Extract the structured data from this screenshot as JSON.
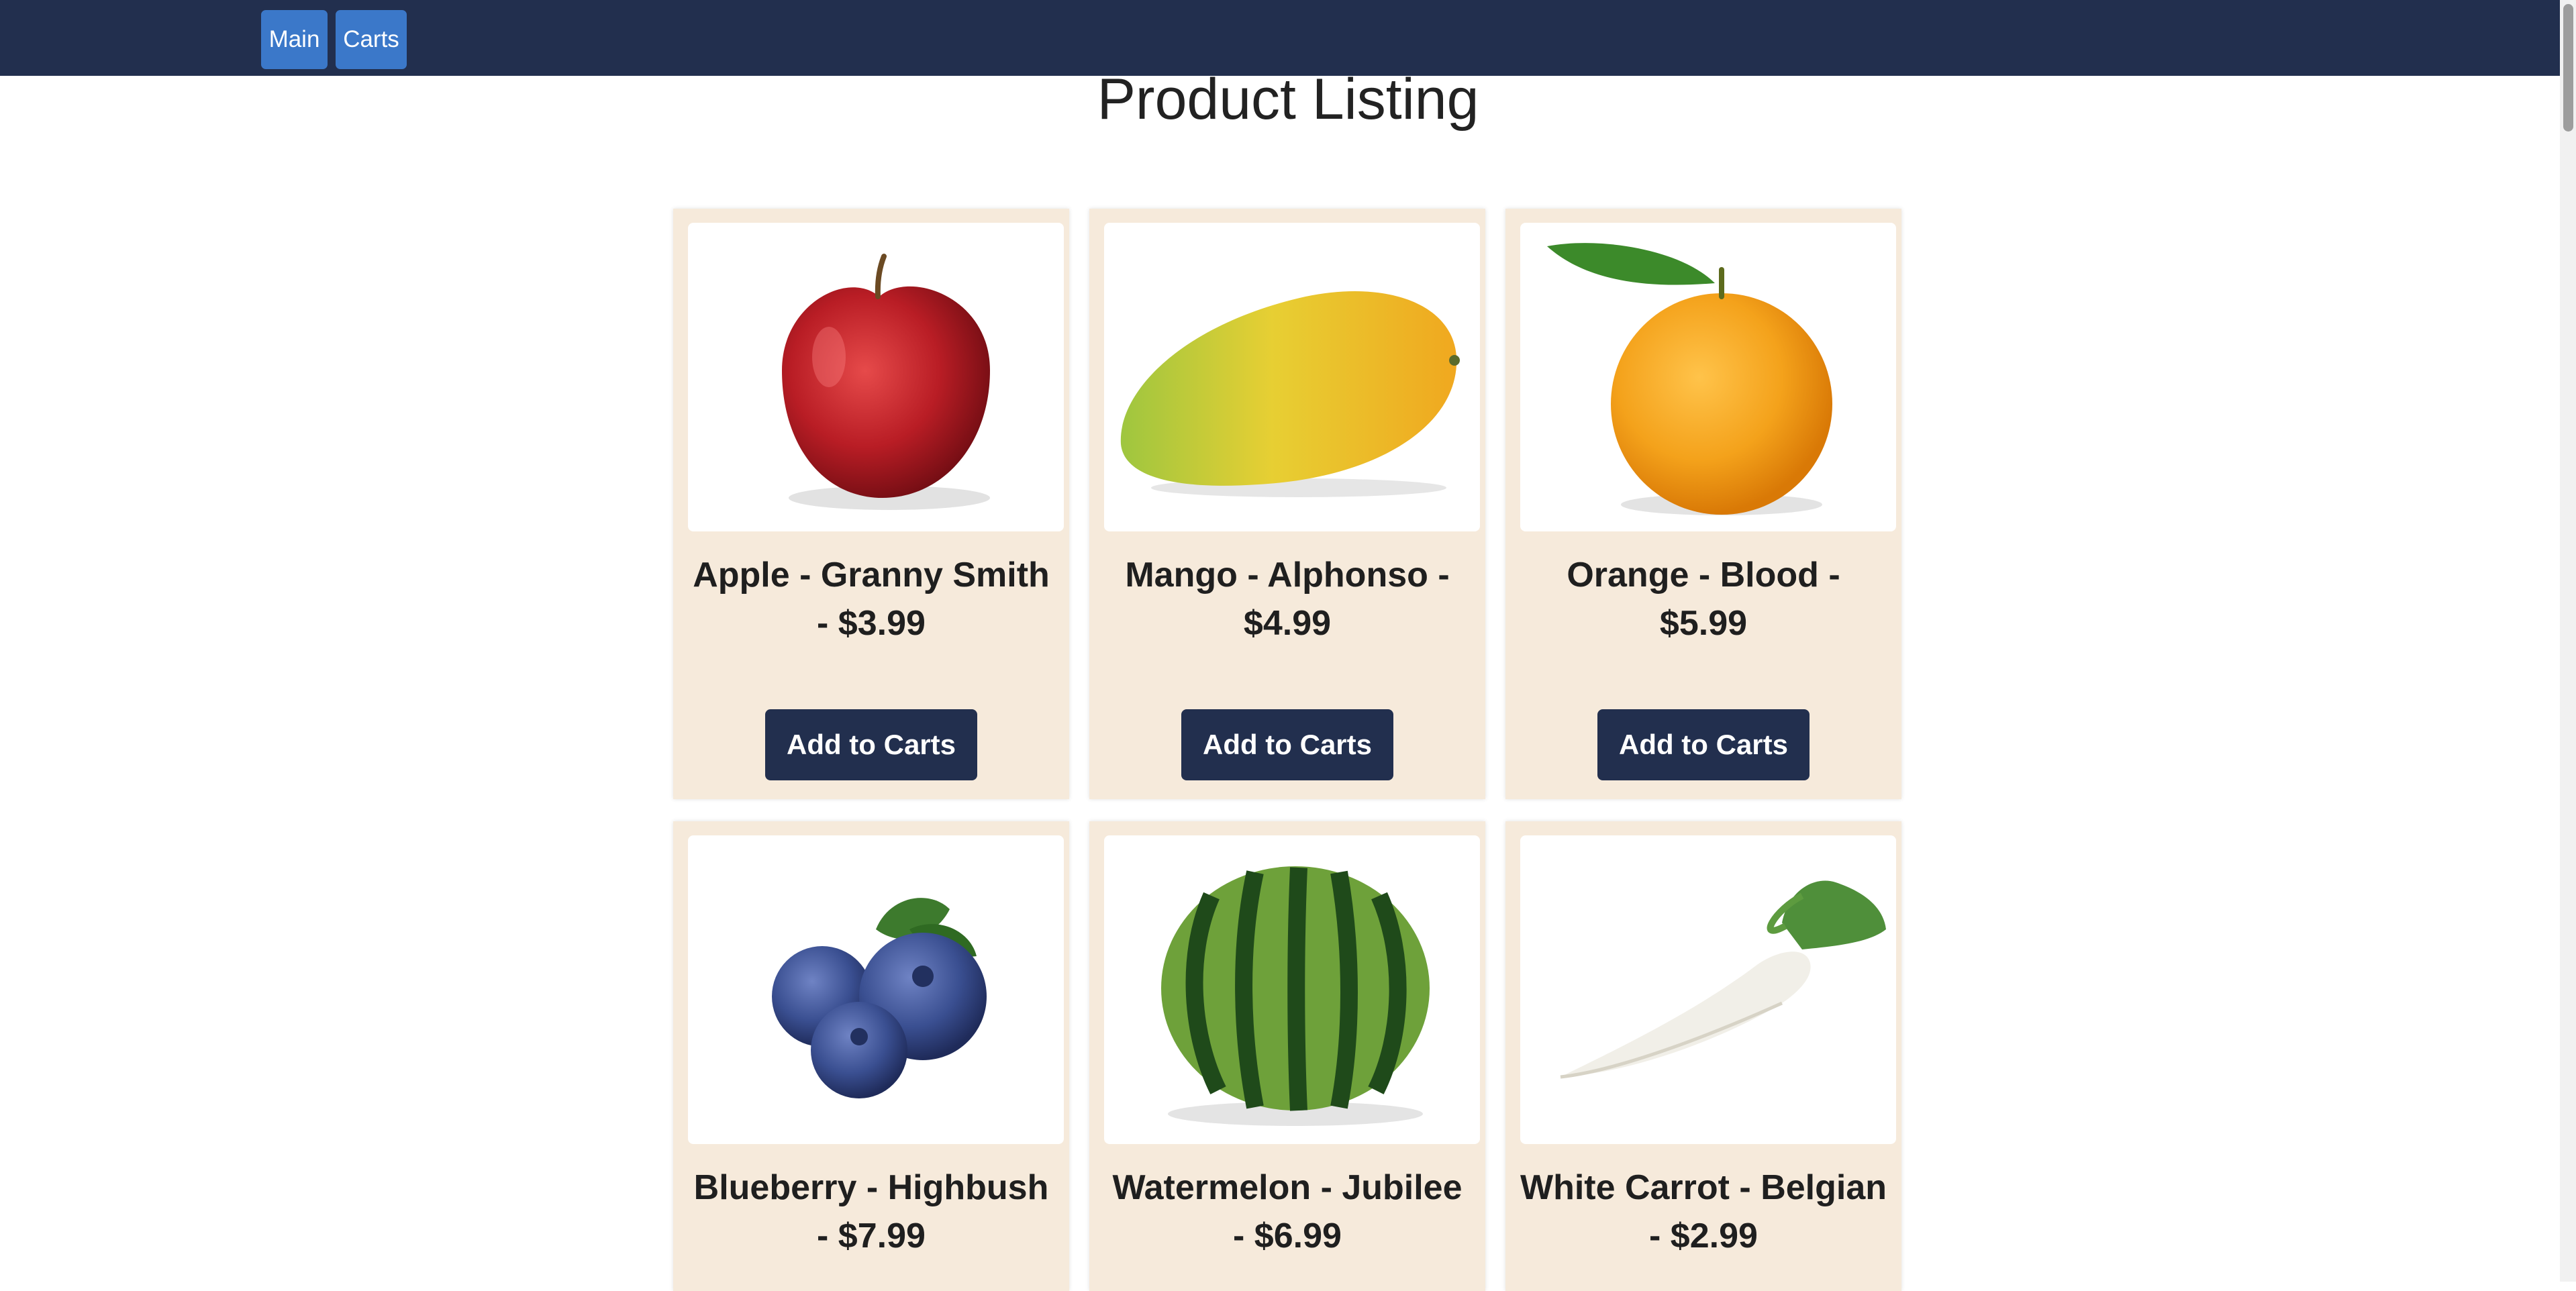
{
  "nav": {
    "main_label": "Main",
    "carts_label": "Carts"
  },
  "page": {
    "title": "Product Listing"
  },
  "products": [
    {
      "name": "Apple - Granny Smith - $3.99",
      "button_label": "Add to Carts",
      "image": "red-apple-image"
    },
    {
      "name": "Mango - Alphonso - $4.99",
      "button_label": "Add to Carts",
      "image": "mango-image"
    },
    {
      "name": "Orange - Blood - $5.99",
      "button_label": "Add to Carts",
      "image": "orange-image"
    },
    {
      "name": "Blueberry - Highbush - $7.99",
      "image": "blueberries-image"
    },
    {
      "name": "Watermelon - Jubilee - $6.99",
      "image": "watermelon-image"
    },
    {
      "name": "White Carrot - Belgian - $2.99",
      "image": "white-carrot-image"
    }
  ],
  "colors": {
    "nav_bg": "#222f4e",
    "nav_button": "#3b78c9",
    "card_bg": "#f6eadb",
    "add_button": "#222f4e"
  }
}
